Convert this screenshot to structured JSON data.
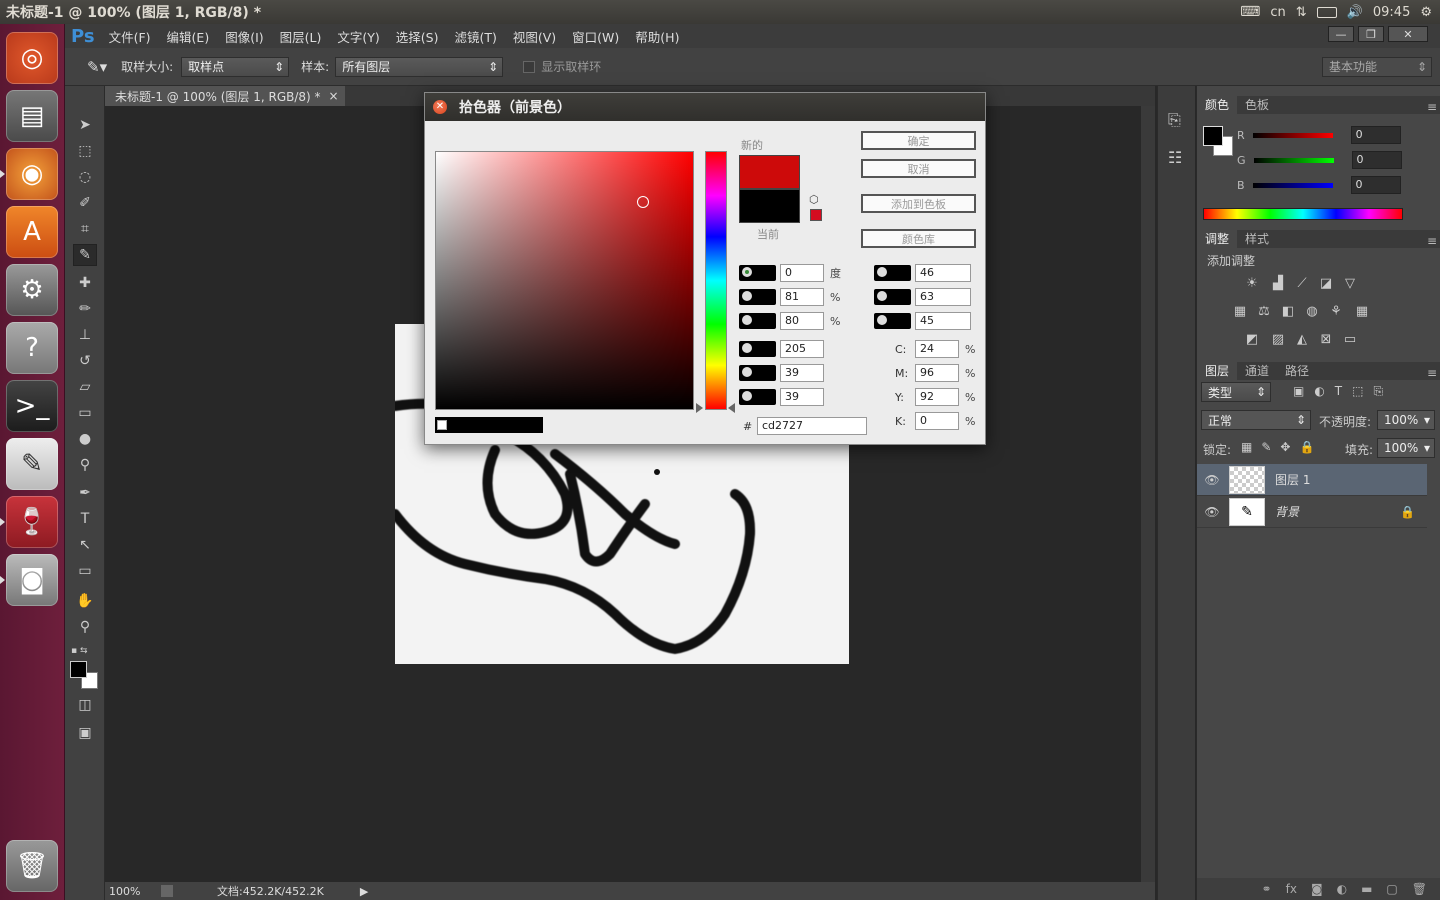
{
  "topbar": {
    "title": "未标题-1 @ 100% (图层 1, RGB/8) *",
    "lang": "cn",
    "time": "09:45"
  },
  "menu": {
    "logo": "Ps",
    "items": [
      "文件(F)",
      "编辑(E)",
      "图像(I)",
      "图层(L)",
      "文字(Y)",
      "选择(S)",
      "滤镜(T)",
      "视图(V)",
      "窗口(W)",
      "帮助(H)"
    ]
  },
  "options": {
    "size_label": "取样大小:",
    "size_value": "取样点",
    "sample_label": "样本:",
    "sample_value": "所有图层",
    "ring_label": "显示取样环",
    "workspace": "基本功能"
  },
  "doc": {
    "tab_title": "未标题-1 @ 100% (图层 1, RGB/8) *",
    "close": "×"
  },
  "status": {
    "zoom": "100%",
    "doc_size": "文档:452.2K/452.2K"
  },
  "color_panel": {
    "tabs": [
      "颜色",
      "色板"
    ],
    "r_label": "R",
    "g_label": "G",
    "b_label": "B",
    "r": "0",
    "g": "0",
    "b": "0"
  },
  "adjust_panel": {
    "tabs": [
      "调整",
      "样式"
    ],
    "add_label": "添加调整"
  },
  "layers_panel": {
    "tabs": [
      "图层",
      "通道",
      "路径"
    ],
    "kind": "类型",
    "blend": "正常",
    "opacity_label": "不透明度:",
    "opacity": "100%",
    "lock_label": "锁定:",
    "fill_label": "填充:",
    "fill": "100%",
    "layers": [
      {
        "name": "图层 1"
      },
      {
        "name": "背景"
      }
    ]
  },
  "dialog": {
    "title": "拾色器（前景色）",
    "new_label": "新的",
    "current_label": "当前",
    "buttons": {
      "ok": "确定",
      "cancel": "取消",
      "add_swatch": "添加到色板",
      "libraries": "颜色库"
    },
    "hsb": {
      "h": "0",
      "s": "81",
      "b": "80",
      "h_unit": "度",
      "s_unit": "%",
      "b_unit": "%"
    },
    "rgb": {
      "r": "205",
      "g": "39",
      "b": "39"
    },
    "lab": {
      "l": "46",
      "a": "63",
      "b": "45"
    },
    "cmyk": {
      "c_label": "C:",
      "m_label": "M:",
      "y_label": "Y:",
      "k_label": "K:",
      "c": "24",
      "m": "96",
      "y": "92",
      "k": "0",
      "unit": "%"
    },
    "hex_label": "#",
    "hex": "cd2727",
    "new_color": "#cd0a0a",
    "current_color": "#000000"
  }
}
